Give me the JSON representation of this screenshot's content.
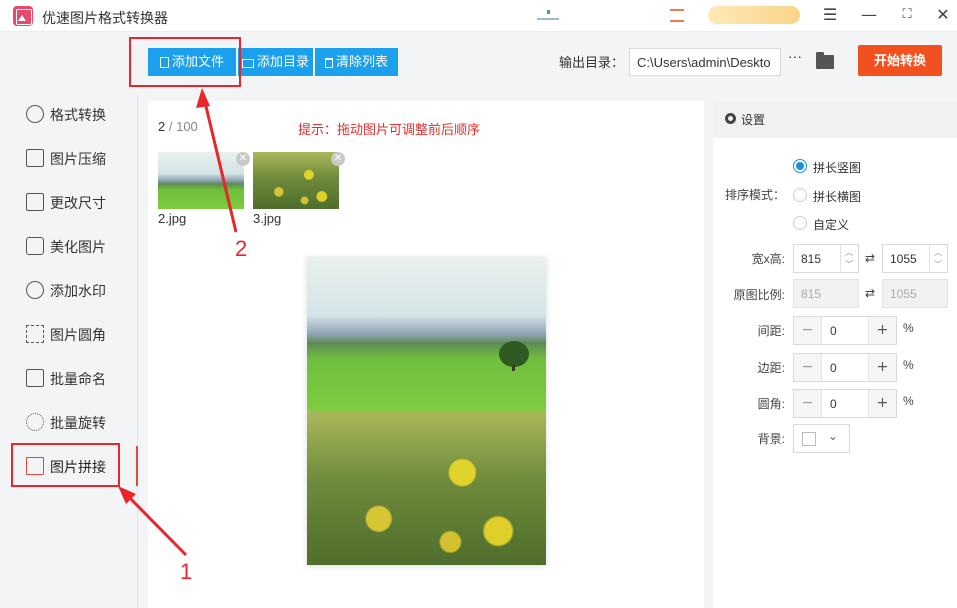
{
  "window": {
    "title": "优速图片格式转换器",
    "controls": {
      "menu": "☰",
      "minimize": "—",
      "maximize": "⛶",
      "close": "✕"
    }
  },
  "toolbar": {
    "add_file": "添加文件",
    "add_folder": "添加目录",
    "clear_list": "清除列表",
    "output_label": "输出目录：",
    "output_path": "C:\\Users\\admin\\Deskto",
    "more": "···",
    "start": "开始转换"
  },
  "sidebar": {
    "items": [
      {
        "label": "格式转换",
        "icon": "format-convert-icon"
      },
      {
        "label": "图片压缩",
        "icon": "compress-icon"
      },
      {
        "label": "更改尺寸",
        "icon": "resize-icon"
      },
      {
        "label": "美化图片",
        "icon": "beautify-icon"
      },
      {
        "label": "添加水印",
        "icon": "watermark-icon"
      },
      {
        "label": "图片圆角",
        "icon": "round-corner-icon"
      },
      {
        "label": "批量命名",
        "icon": "rename-icon"
      },
      {
        "label": "批量旋转",
        "icon": "rotate-icon"
      },
      {
        "label": "图片拼接",
        "icon": "stitch-icon",
        "active": true
      }
    ]
  },
  "main": {
    "count_current": "2",
    "count_total": "/ 100",
    "hint": "提示：拖动图片可调整前后顺序",
    "thumbnails": [
      {
        "name": "2.jpg"
      },
      {
        "name": "3.jpg"
      }
    ]
  },
  "settings": {
    "title": "设置",
    "sort_label": "排序模式：",
    "sort_options": [
      "拼长竖图",
      "拼长横图",
      "自定义"
    ],
    "sort_selected": 0,
    "size_label": "宽x高:",
    "width": "815",
    "height": "1055",
    "ratio_label": "原图比例:",
    "ratio_width": "815",
    "ratio_height": "1055",
    "gap_label": "间距:",
    "gap_value": "0",
    "margin_label": "边距:",
    "margin_value": "0",
    "corner_label": "圆角:",
    "corner_value": "0",
    "percent": "%",
    "bg_label": "背景:"
  },
  "annotations": {
    "label_1": "1",
    "label_2": "2",
    "color": "#e8262b"
  },
  "colors": {
    "primary_button": "#1aa0ec",
    "start_button": "#f2501f",
    "hint_text": "#e0302b",
    "radio_selected": "#1a8fe0"
  }
}
